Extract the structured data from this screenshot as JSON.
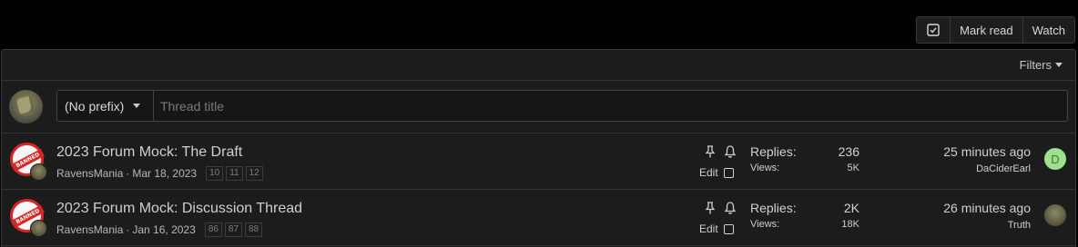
{
  "toolbar": {
    "mark_read_label": "Mark read",
    "watch_label": "Watch"
  },
  "filters_label": "Filters",
  "new_thread": {
    "prefix_value": "(No prefix)",
    "title_placeholder": "Thread title"
  },
  "threads": [
    {
      "title": "2023 Forum Mock: The Draft",
      "author": "RavensMania",
      "separator": "·",
      "date": "Mar 18, 2023",
      "pages": [
        "10",
        "11",
        "12"
      ],
      "edit_label": "Edit",
      "replies_label": "Replies:",
      "replies": "236",
      "views_label": "Views:",
      "views": "5K",
      "last_time": "25 minutes ago",
      "last_user": "DaCiderEarl",
      "last_avatar_letter": "D"
    },
    {
      "title": "2023 Forum Mock: Discussion Thread",
      "author": "RavensMania",
      "separator": "·",
      "date": "Jan 16, 2023",
      "pages": [
        "86",
        "87",
        "88"
      ],
      "edit_label": "Edit",
      "replies_label": "Replies:",
      "replies": "2K",
      "views_label": "Views:",
      "views": "18K",
      "last_time": "26 minutes ago",
      "last_user": "Truth"
    }
  ],
  "avatar_badge_text": "BANNED",
  "colors": {
    "background": "#000000",
    "panel": "#1c1c1c",
    "border": "#3a3a3a",
    "banned_red": "#d42828",
    "avatar_green": "#9ee08f"
  }
}
